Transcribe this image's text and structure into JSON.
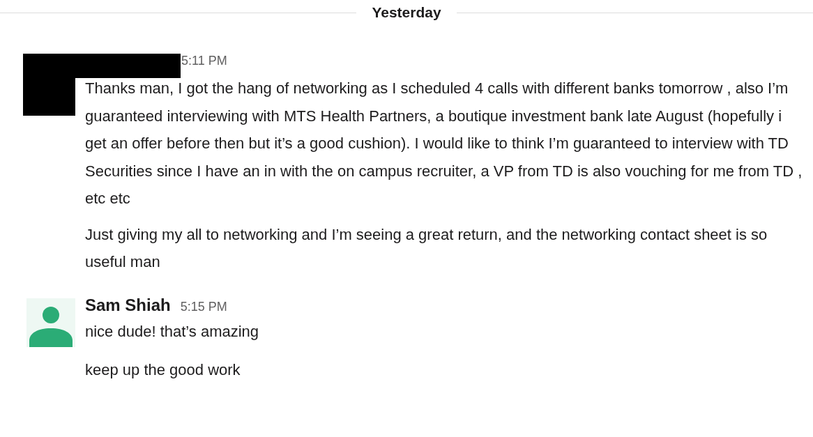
{
  "day_divider": {
    "label": "Yesterday"
  },
  "messages": [
    {
      "kind": "redacted",
      "time": "5:11 PM",
      "paragraphs": [
        "Thanks man, I got the hang of networking as I scheduled 4 calls with different banks tomorrow , also I’m guaranteed interviewing with MTS Health Partners, a boutique investment bank late August (hopefully i get an offer before then but it’s a good cushion).  I would like to think I’m guaranteed to interview with TD Securities since I have an in with the on campus recruiter, a VP from TD is also vouching for me from TD , etc etc",
        "Just giving my all to networking and I’m seeing a great return, and the networking contact sheet is so useful man"
      ]
    },
    {
      "kind": "named",
      "sender": "Sam Shiah",
      "time": "5:15 PM",
      "paragraphs": [
        "nice dude! that’s amazing",
        "keep up the good work"
      ]
    }
  ]
}
